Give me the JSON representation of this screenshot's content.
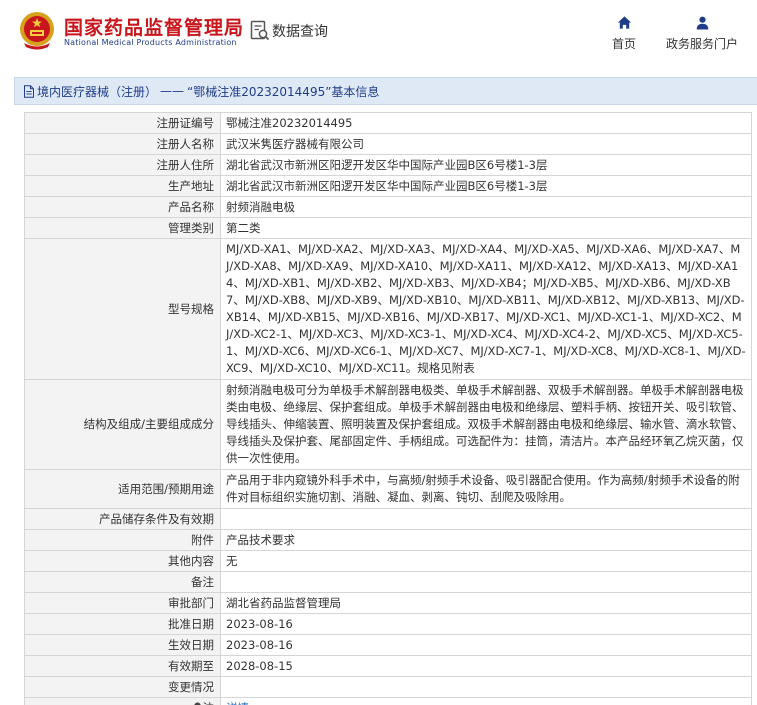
{
  "header": {
    "site_title": "国家药品监督管理局",
    "site_subtitle": "National Medical Products Administration",
    "data_query_label": "数据查询",
    "nav": [
      {
        "label": "首页",
        "icon": "home-icon"
      },
      {
        "label": "政务服务门户",
        "icon": "user-icon"
      }
    ],
    "brand_color": "#c8161d",
    "accent_color": "#1f3c88"
  },
  "breadcrumb": {
    "section": "境内医疗器械（注册）",
    "separator": "——",
    "record_title": "“鄂械注准20232014495”基本信息"
  },
  "record": {
    "fields": [
      {
        "label": "注册证编号",
        "value": "鄂械注准20232014495"
      },
      {
        "label": "注册人名称",
        "value": "武汉米隽医疗器械有限公司"
      },
      {
        "label": "注册人住所",
        "value": "湖北省武汉市新洲区阳逻开发区华中国际产业园B区6号楼1-3层"
      },
      {
        "label": "生产地址",
        "value": "湖北省武汉市新洲区阳逻开发区华中国际产业园B区6号楼1-3层"
      },
      {
        "label": "产品名称",
        "value": "射频消融电极"
      },
      {
        "label": "管理类别",
        "value": "第二类"
      },
      {
        "label": "型号规格",
        "value": "MJ/XD-XA1、MJ/XD-XA2、MJ/XD-XA3、MJ/XD-XA4、MJ/XD-XA5、MJ/XD-XA6、MJ/XD-XA7、MJ/XD-XA8、MJ/XD-XA9、MJ/XD-XA10、MJ/XD-XA11、MJ/XD-XA12、MJ/XD-XA13、MJ/XD-XA14、MJ/XD-XB1、MJ/XD-XB2、MJ/XD-XB3、MJ/XD-XB4；MJ/XD-XB5、MJ/XD-XB6、MJ/XD-XB7、MJ/XD-XB8、MJ/XD-XB9、MJ/XD-XB10、MJ/XD-XB11、MJ/XD-XB12、MJ/XD-XB13、MJ/XD-XB14、MJ/XD-XB15、MJ/XD-XB16、MJ/XD-XB17、MJ/XD-XC1、MJ/XD-XC1-1、MJ/XD-XC2、MJ/XD-XC2-1、MJ/XD-XC3、MJ/XD-XC3-1、MJ/XD-XC4、MJ/XD-XC4-2、MJ/XD-XC5、MJ/XD-XC5-1、MJ/XD-XC6、MJ/XD-XC6-1、MJ/XD-XC7、MJ/XD-XC7-1、MJ/XD-XC8、MJ/XD-XC8-1、MJ/XD-XC9、MJ/XD-XC10、MJ/XD-XC11。规格见附表"
      },
      {
        "label": "结构及组成/主要组成成分",
        "value": "射频消融电极可分为单极手术解剖器电极类、单极手术解剖器、双极手术解剖器。单极手术解剖器电极类由电极、绝缘层、保护套组成。单极手术解剖器由电极和绝缘层、塑料手柄、按钮开关、吸引软管、导线插头、伸缩装置、照明装置及保护套组成。双极手术解剖器由电极和绝缘层、输水管、滴水软管、导线插头及保护套、尾部固定件、手柄组成。可选配件为：挂筒，清洁片。本产品经环氧乙烷灭菌，仅供一次性使用。"
      },
      {
        "label": "适用范围/预期用途",
        "value": "产品用于非内窥镜外科手术中，与高频/射频手术设备、吸引器配合使用。作为高频/射频手术设备的附件对目标组织实施切割、消融、凝血、剥离、钝切、刮爬及吸除用。"
      },
      {
        "label": "产品储存条件及有效期",
        "value": ""
      },
      {
        "label": "附件",
        "value": "产品技术要求"
      },
      {
        "label": "其他内容",
        "value": "无"
      },
      {
        "label": "备注",
        "value": ""
      },
      {
        "label": "审批部门",
        "value": "湖北省药品监督管理局"
      },
      {
        "label": "批准日期",
        "value": "2023-08-16"
      },
      {
        "label": "生效日期",
        "value": "2023-08-16"
      },
      {
        "label": "有效期至",
        "value": "2028-08-15"
      },
      {
        "label": "变更情况",
        "value": ""
      },
      {
        "label": "注",
        "value": "详情",
        "icon": "pin-icon"
      }
    ]
  }
}
